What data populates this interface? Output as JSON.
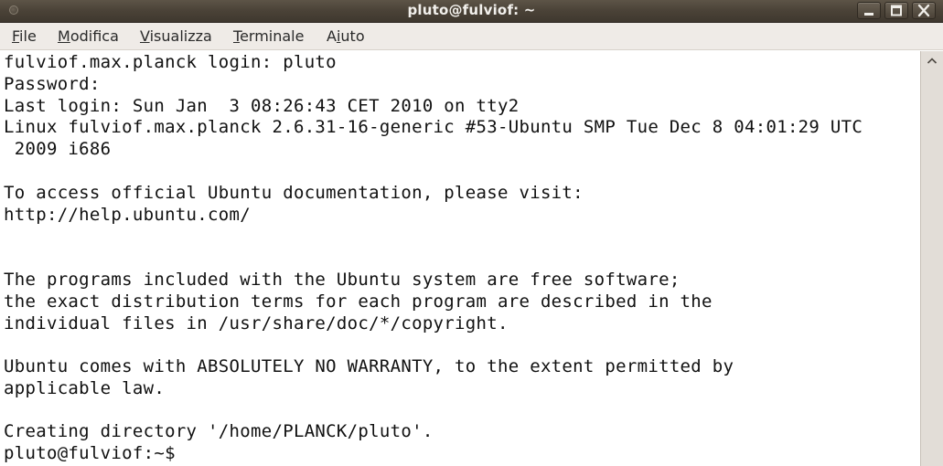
{
  "window": {
    "title": "pluto@fulviof: ~"
  },
  "menu": {
    "items": [
      {
        "mnemonic": "F",
        "rest": "ile"
      },
      {
        "mnemonic": "M",
        "rest": "odifica"
      },
      {
        "mnemonic": "V",
        "rest": "isualizza"
      },
      {
        "mnemonic": "T",
        "rest": "erminale"
      },
      {
        "pre": "A",
        "mnemonic": "i",
        "rest": "uto"
      }
    ]
  },
  "terminal": {
    "lines": [
      "fulviof.max.planck login: pluto",
      "Password:",
      "Last login: Sun Jan  3 08:26:43 CET 2010 on tty2",
      "Linux fulviof.max.planck 2.6.31-16-generic #53-Ubuntu SMP Tue Dec 8 04:01:29 UTC",
      " 2009 i686",
      "",
      "To access official Ubuntu documentation, please visit:",
      "http://help.ubuntu.com/",
      "",
      "",
      "The programs included with the Ubuntu system are free software;",
      "the exact distribution terms for each program are described in the",
      "individual files in /usr/share/doc/*/copyright.",
      "",
      "Ubuntu comes with ABSOLUTELY NO WARRANTY, to the extent permitted by",
      "applicable law.",
      "",
      "Creating directory '/home/PLANCK/pluto'.",
      "pluto@fulviof:~$"
    ]
  },
  "icons": {
    "window_menu": "window-menu-icon",
    "minimize": "minimize-icon",
    "maximize": "maximize-icon",
    "close": "close-icon",
    "scroll_up": "scroll-up-arrow-icon"
  }
}
